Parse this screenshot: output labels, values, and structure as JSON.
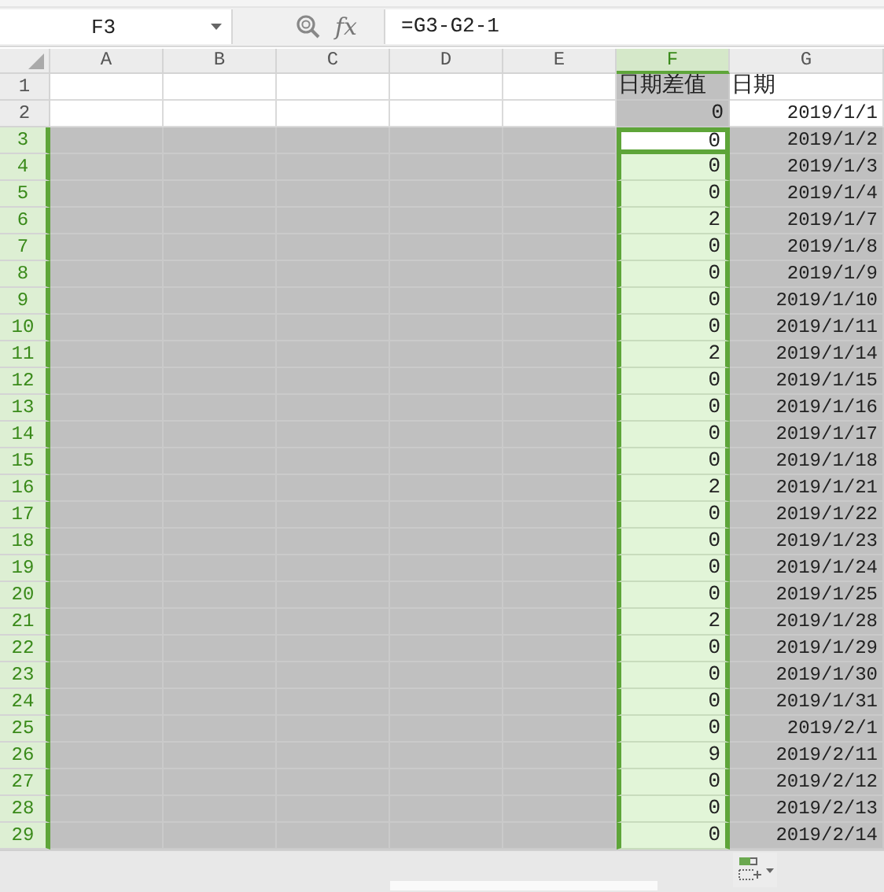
{
  "name_box": {
    "value": "F3"
  },
  "formula_bar": {
    "fx": "fx",
    "formula": "=G3-G2-1"
  },
  "columns": [
    {
      "label": "A",
      "selected": false
    },
    {
      "label": "B",
      "selected": false
    },
    {
      "label": "C",
      "selected": false
    },
    {
      "label": "D",
      "selected": false
    },
    {
      "label": "E",
      "selected": false
    },
    {
      "label": "F",
      "selected": true
    },
    {
      "label": "G",
      "selected": false
    }
  ],
  "rows": [
    {
      "label": "1",
      "kind": "heading",
      "selected": false,
      "active": false,
      "difference": "日期差值",
      "date": "日期"
    },
    {
      "label": "2",
      "kind": "data",
      "selected": false,
      "active": false,
      "difference": "0",
      "date": "2019/1/1"
    },
    {
      "label": "3",
      "kind": "data",
      "selected": true,
      "active": true,
      "difference": "0",
      "date": "2019/1/2"
    },
    {
      "label": "4",
      "kind": "data",
      "selected": true,
      "active": false,
      "difference": "0",
      "date": "2019/1/3"
    },
    {
      "label": "5",
      "kind": "data",
      "selected": true,
      "active": false,
      "difference": "0",
      "date": "2019/1/4"
    },
    {
      "label": "6",
      "kind": "data",
      "selected": true,
      "active": false,
      "difference": "2",
      "date": "2019/1/7"
    },
    {
      "label": "7",
      "kind": "data",
      "selected": true,
      "active": false,
      "difference": "0",
      "date": "2019/1/8"
    },
    {
      "label": "8",
      "kind": "data",
      "selected": true,
      "active": false,
      "difference": "0",
      "date": "2019/1/9"
    },
    {
      "label": "9",
      "kind": "data",
      "selected": true,
      "active": false,
      "difference": "0",
      "date": "2019/1/10"
    },
    {
      "label": "10",
      "kind": "data",
      "selected": true,
      "active": false,
      "difference": "0",
      "date": "2019/1/11"
    },
    {
      "label": "11",
      "kind": "data",
      "selected": true,
      "active": false,
      "difference": "2",
      "date": "2019/1/14"
    },
    {
      "label": "12",
      "kind": "data",
      "selected": true,
      "active": false,
      "difference": "0",
      "date": "2019/1/15"
    },
    {
      "label": "13",
      "kind": "data",
      "selected": true,
      "active": false,
      "difference": "0",
      "date": "2019/1/16"
    },
    {
      "label": "14",
      "kind": "data",
      "selected": true,
      "active": false,
      "difference": "0",
      "date": "2019/1/17"
    },
    {
      "label": "15",
      "kind": "data",
      "selected": true,
      "active": false,
      "difference": "0",
      "date": "2019/1/18"
    },
    {
      "label": "16",
      "kind": "data",
      "selected": true,
      "active": false,
      "difference": "2",
      "date": "2019/1/21"
    },
    {
      "label": "17",
      "kind": "data",
      "selected": true,
      "active": false,
      "difference": "0",
      "date": "2019/1/22"
    },
    {
      "label": "18",
      "kind": "data",
      "selected": true,
      "active": false,
      "difference": "0",
      "date": "2019/1/23"
    },
    {
      "label": "19",
      "kind": "data",
      "selected": true,
      "active": false,
      "difference": "0",
      "date": "2019/1/24"
    },
    {
      "label": "20",
      "kind": "data",
      "selected": true,
      "active": false,
      "difference": "0",
      "date": "2019/1/25"
    },
    {
      "label": "21",
      "kind": "data",
      "selected": true,
      "active": false,
      "difference": "2",
      "date": "2019/1/28"
    },
    {
      "label": "22",
      "kind": "data",
      "selected": true,
      "active": false,
      "difference": "0",
      "date": "2019/1/29"
    },
    {
      "label": "23",
      "kind": "data",
      "selected": true,
      "active": false,
      "difference": "0",
      "date": "2019/1/30"
    },
    {
      "label": "24",
      "kind": "data",
      "selected": true,
      "active": false,
      "difference": "0",
      "date": "2019/1/31"
    },
    {
      "label": "25",
      "kind": "data",
      "selected": true,
      "active": false,
      "difference": "0",
      "date": "2019/2/1"
    },
    {
      "label": "26",
      "kind": "data",
      "selected": true,
      "active": false,
      "difference": "9",
      "date": "2019/2/11"
    },
    {
      "label": "27",
      "kind": "data",
      "selected": true,
      "active": false,
      "difference": "0",
      "date": "2019/2/12"
    },
    {
      "label": "28",
      "kind": "data",
      "selected": true,
      "active": false,
      "difference": "0",
      "date": "2019/2/13"
    },
    {
      "label": "29",
      "kind": "data",
      "selected": true,
      "active": false,
      "difference": "0",
      "date": "2019/2/14"
    }
  ]
}
